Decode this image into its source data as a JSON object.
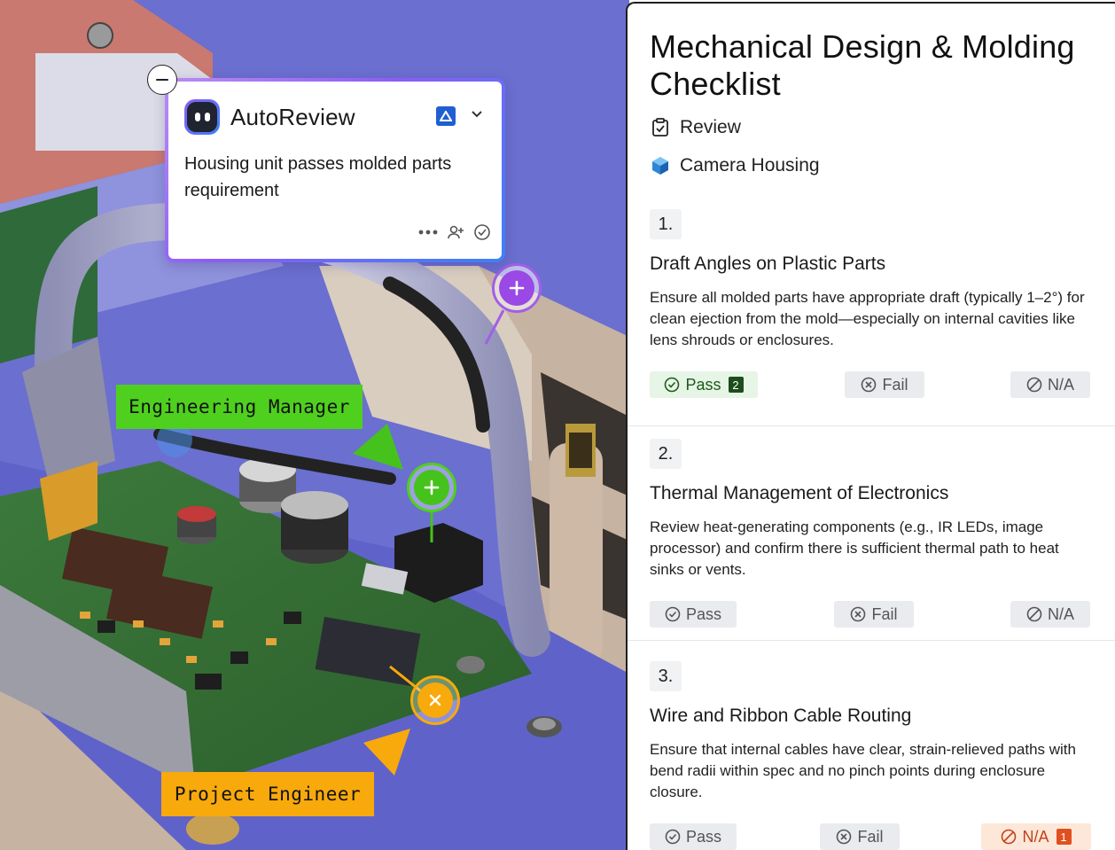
{
  "autoreview": {
    "title": "AutoReview",
    "message": "Housing unit passes molded parts requirement"
  },
  "callouts": {
    "engineering_manager": "Engineering Manager",
    "project_engineer": "Project Engineer"
  },
  "colors": {
    "purple": "#9a48e6",
    "green": "#4fd01e",
    "orange": "#f8a90c",
    "pass_bg": "#e6f5e6",
    "na_bg": "#fde7d8"
  },
  "checklist": {
    "title": "Mechanical Design & Molding Checklist",
    "review_label": "Review",
    "part_label": "Camera Housing",
    "items": [
      {
        "number": "1.",
        "title": "Draft Angles on Plastic Parts",
        "description": "Ensure all molded parts have appropriate draft (typically 1–2°) for clean ejection from the mold—especially on internal cavities like lens shrouds or enclosures.",
        "pass": "Pass",
        "fail": "Fail",
        "na": "N/A",
        "pass_count": "2",
        "selected": "pass"
      },
      {
        "number": "2.",
        "title": "Thermal Management of Electronics",
        "description": "Review heat-generating components (e.g., IR LEDs, image processor) and confirm there is sufficient thermal path to heat sinks or vents.",
        "pass": "Pass",
        "fail": "Fail",
        "na": "N/A",
        "selected": "none"
      },
      {
        "number": "3.",
        "title": "Wire and Ribbon Cable Routing",
        "description": "Ensure that internal cables have clear, strain-relieved paths with bend radii within spec and no pinch points during enclosure closure.",
        "pass": "Pass",
        "fail": "Fail",
        "na": "N/A",
        "na_count": "1",
        "selected": "na"
      }
    ]
  }
}
